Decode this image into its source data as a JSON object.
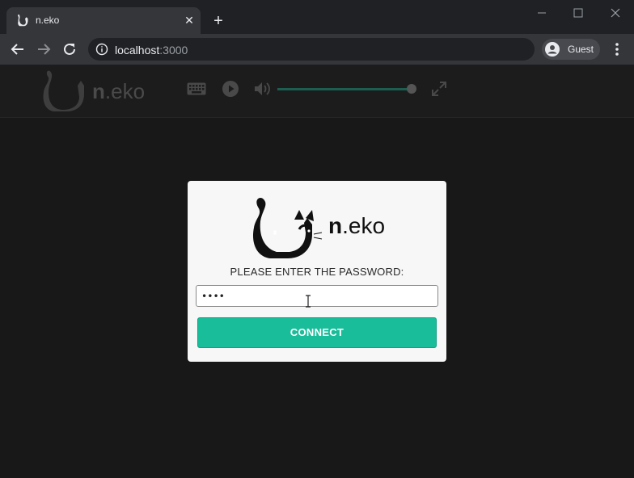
{
  "browser": {
    "tab": {
      "title": "n.eko",
      "favicon_icon": "cat-icon"
    },
    "new_tab_icon": "plus-icon",
    "window_controls": [
      "minimize-icon",
      "maximize-icon",
      "close-icon"
    ],
    "address": {
      "host": "localhost",
      "port": ":3000",
      "info_icon": "info-icon"
    },
    "profile": {
      "label": "Guest",
      "icon": "account-circle-icon"
    },
    "menu_icon": "kebab-menu-icon"
  },
  "app": {
    "brand_bold": "n",
    "brand_rest": ".eko",
    "controls": [
      "keyboard-icon",
      "play-icon",
      "volume-icon",
      "fullscreen-icon"
    ],
    "volume_level": 1.0
  },
  "login": {
    "brand_bold": "n",
    "brand_rest": ".eko",
    "prompt": "PLEASE ENTER THE PASSWORD:",
    "password_value": "••••",
    "connect_label": "CONNECT"
  },
  "colors": {
    "accent": "#19bd9a",
    "background": "#181818",
    "dialog": "#f7f7f7"
  }
}
